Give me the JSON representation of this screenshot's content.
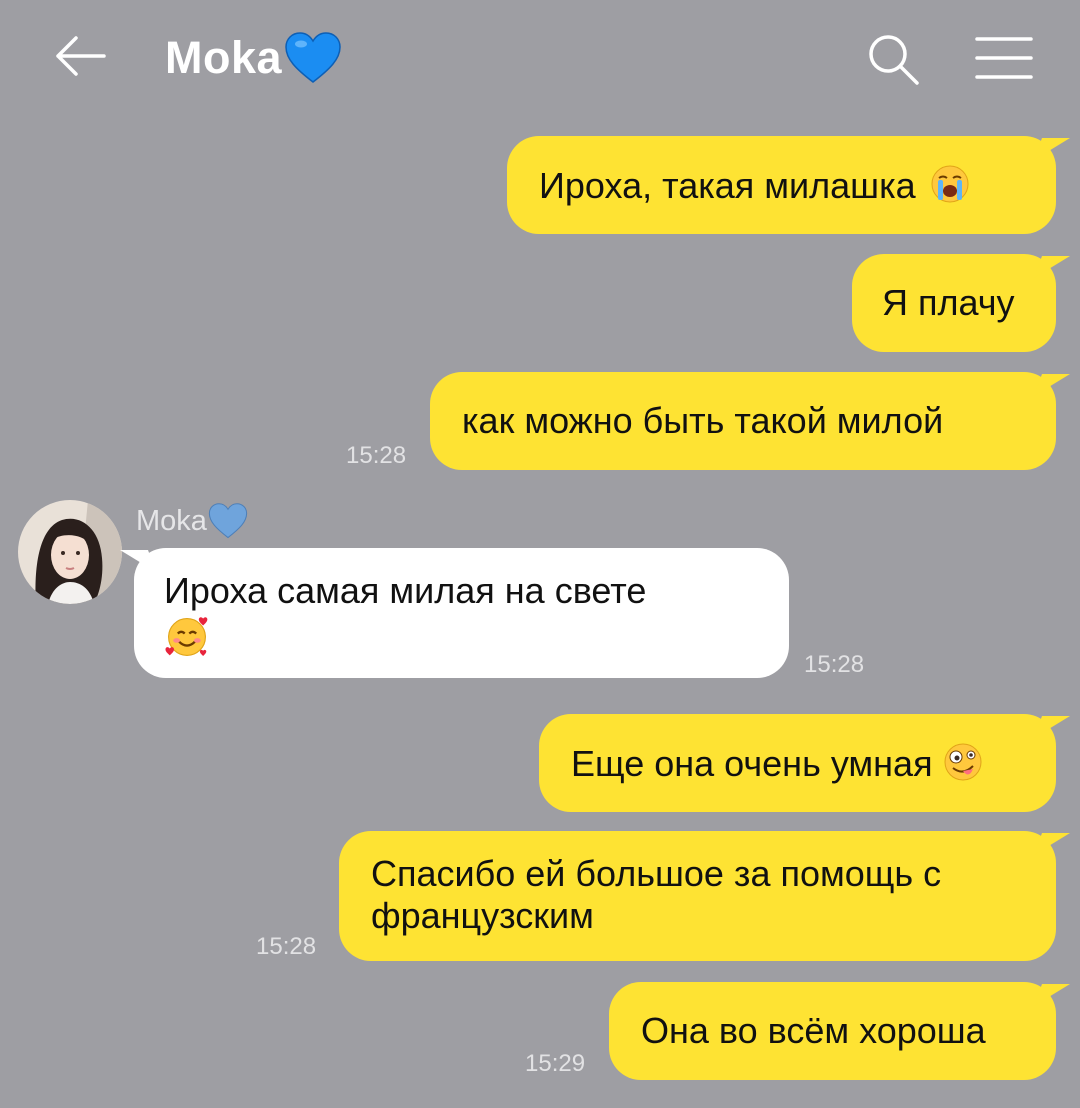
{
  "header": {
    "title": "Moka",
    "title_emoji": "blue-heart"
  },
  "contact": {
    "name": "Moka"
  },
  "messages": [
    {
      "dir": "out",
      "text": "Ироха, такая милашка",
      "emoji": "loudly-crying-face"
    },
    {
      "dir": "out",
      "text": "Я плачу"
    },
    {
      "dir": "out",
      "text": "как можно быть такой милой",
      "time": "15:28"
    },
    {
      "dir": "in",
      "text": "Ироха самая милая на свете",
      "emoji": "smiling-face-with-hearts",
      "time": "15:28"
    },
    {
      "dir": "out",
      "text": "Еще она очень умная",
      "emoji": "zany-face"
    },
    {
      "dir": "out",
      "line1": "Спасибо ей большое за помощь с",
      "line2": "французским",
      "time": "15:28"
    },
    {
      "dir": "out",
      "text": "Она во всём хороша",
      "time": "15:29"
    }
  ],
  "colors": {
    "background": "#9e9ea3",
    "outgoing_bubble": "#fee333",
    "incoming_bubble": "#ffffff"
  }
}
